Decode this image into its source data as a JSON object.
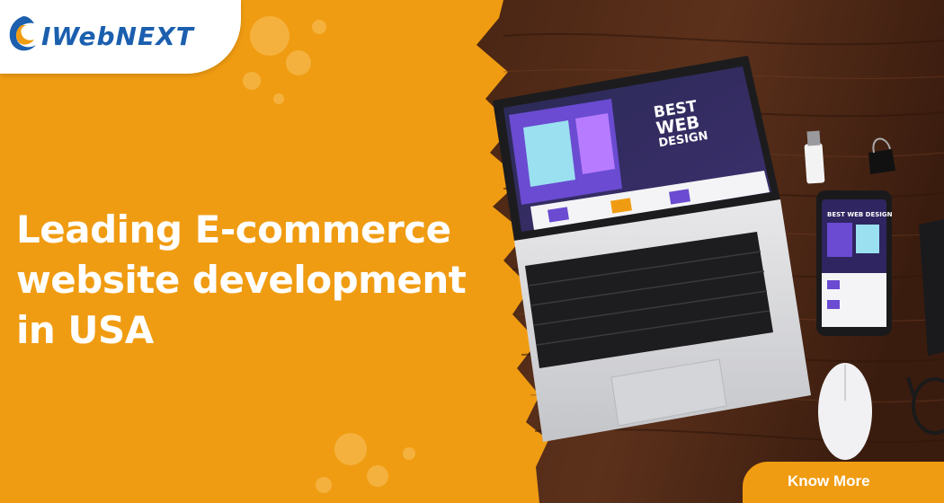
{
  "brand": {
    "name": "iwebnext",
    "logo_text": "IWebNEXT",
    "color_primary": "#1b5fae",
    "color_accent": "#f09c12"
  },
  "hero": {
    "headline_lines": [
      "Leading E-commerce",
      "website development",
      "in USA"
    ]
  },
  "cta": {
    "label": "Know More"
  },
  "screen": {
    "laptop_text_lines": [
      "BEST",
      "WEB",
      "DESIGN"
    ],
    "phone_text": "BEST WEB DESIGN"
  },
  "icons": {
    "logo": "iwebnext-logo-mark",
    "laptop": "laptop-illustration",
    "phone": "smartphone-illustration",
    "mouse": "mouse-illustration",
    "usb": "usb-drive-illustration",
    "clip": "binder-clip-illustration",
    "glasses": "eyeglasses-illustration"
  },
  "colors": {
    "background_orange": "#f09c12",
    "wood_dark": "#3e2012",
    "headline_text": "#ffffff"
  }
}
